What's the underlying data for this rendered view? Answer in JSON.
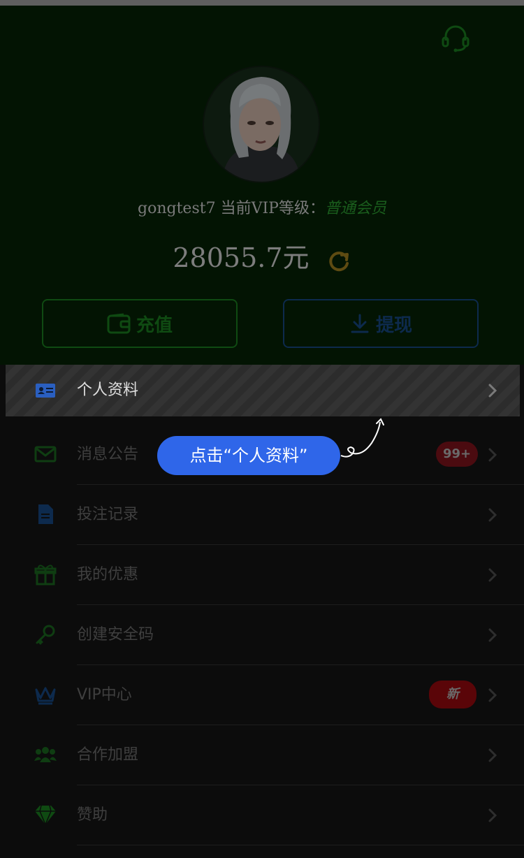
{
  "user": {
    "name": "gongtest7",
    "vip_prefix": "当前VIP等级：",
    "vip_level": "普通会员"
  },
  "wallet": {
    "balance": "28055.7元"
  },
  "actions": {
    "recharge": "充值",
    "withdraw": "提现"
  },
  "menu": [
    {
      "label": "个人资料",
      "icon": "id-card-icon"
    },
    {
      "label": "消息公告",
      "icon": "mail-icon",
      "badge": "99+"
    },
    {
      "label": "投注记录",
      "icon": "document-icon"
    },
    {
      "label": "我的优惠",
      "icon": "gift-icon"
    },
    {
      "label": "创建安全码",
      "icon": "key-icon"
    },
    {
      "label": "VIP中心",
      "icon": "crown-icon",
      "badge": "新"
    },
    {
      "label": "合作加盟",
      "icon": "group-icon"
    },
    {
      "label": "赞助",
      "icon": "diamond-icon"
    }
  ],
  "tooltip": {
    "text": "点击“个人资料”"
  },
  "colors": {
    "header_bg": "#031403",
    "accent_blue": "#2f66e9",
    "vip_green": "#1a5d1d",
    "badge_red": "#4b0b10"
  }
}
